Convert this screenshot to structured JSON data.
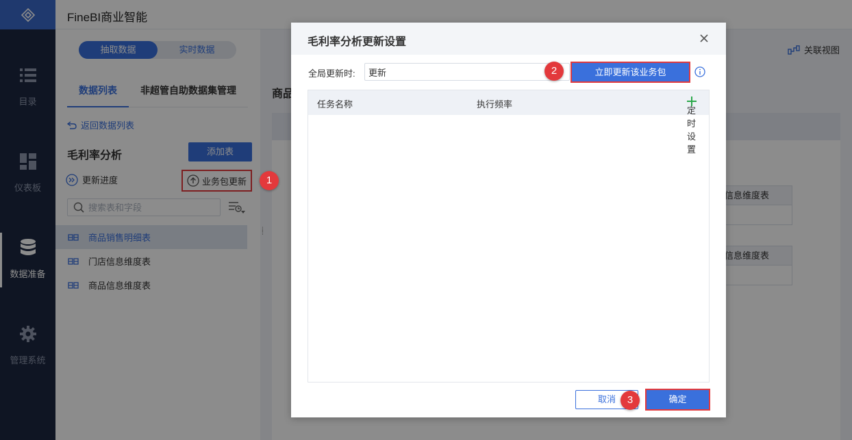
{
  "app": {
    "title": "FineBI商业智能"
  },
  "nav": {
    "logo_icon": "finebi-logo-icon",
    "items": [
      {
        "label": "目录",
        "icon": "list-icon"
      },
      {
        "label": "仪表板",
        "icon": "dashboard-icon"
      },
      {
        "label": "数据准备",
        "icon": "database-icon",
        "active": true
      },
      {
        "label": "管理系统",
        "icon": "gear-icon"
      }
    ]
  },
  "left": {
    "mode_tabs": [
      "抽取数据",
      "实时数据"
    ],
    "tabs": [
      "数据列表",
      "非超管自助数据集管理"
    ],
    "back_link": "返回数据列表",
    "package_title": "毛利率分析",
    "add_table": "添加表",
    "progress": "更新进度",
    "package_update": "业务包更新",
    "search_placeholder": "搜索表和字段",
    "tables": [
      "商品销售明细表",
      "门店信息维度表",
      "商品信息维度表"
    ]
  },
  "right": {
    "title_partial": "商品",
    "relation_view": "关联视图",
    "cards": [
      "信息维度表",
      "信息维度表"
    ]
  },
  "modal": {
    "title": "毛利率分析更新设置",
    "global_label": "全局更新时:",
    "global_value": "更新",
    "update_now": "立即更新该业务包",
    "table_headers": {
      "task_name": "任务名称",
      "frequency": "执行频率",
      "timer": "定时设置"
    },
    "cancel": "取消",
    "confirm": "确定"
  },
  "steps": [
    "1",
    "2",
    "3"
  ],
  "colors": {
    "accent": "#3a70dc",
    "highlight": "#e3393c",
    "nav_bg": "#1d2740"
  }
}
